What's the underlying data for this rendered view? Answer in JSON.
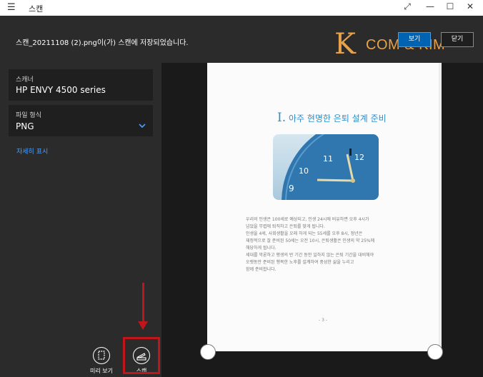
{
  "window": {
    "title": "스캔",
    "menu_glyph": "☰",
    "controls": {
      "restore": "⤢",
      "minimize": "—",
      "maximize": "☐",
      "close": "✕"
    }
  },
  "notification": {
    "message": "스캔_20211108 (2).png이(가) 스캔에 저장되었습니다.",
    "view_label": "보기",
    "close_label": "닫기"
  },
  "watermark": {
    "letter": "K",
    "text": "COM & KIM"
  },
  "settings": {
    "scanner_label": "스캐너",
    "scanner_value": "HP ENVY 4500 series",
    "format_label": "파일 형식",
    "format_value": "PNG",
    "more_link": "자세히 표시"
  },
  "actions": {
    "preview_label": "미리 보기",
    "scan_label": "스캔"
  },
  "document": {
    "heading_number": "I.",
    "heading_text": "아주 현명한 은퇴 설계 준비",
    "clock_numbers": [
      "9",
      "10",
      "11",
      "12"
    ],
    "body_lines": [
      "우리의 인생은 100세로 예상되고, 인생 24시에 비유하면 오후 4시가",
      "넘었을 무렵에 퇴직하고 은퇴를 맞게 됩니다.",
      "인생을 4세, 사회생활을 오래 하게 되는 55세를 오후 8시, 정년은",
      "재정적으로 잘 준비된 50세는 오전 10시, 은퇴생활은 인생의 약 25%에",
      "해당하게 됩니다.",
      "세대를 막론하고 평생의 반 기간 동안 일하지 않는 은퇴 기간을 대비해야",
      "오랫동안 준비된 행복한 노후를 설계하여 풍성한 삶을 누리고",
      "함께 준비합니다."
    ],
    "page_number": "- 3 -"
  },
  "colors": {
    "accent": "#0063b1",
    "link": "#4aa0ff",
    "highlight": "#c0151b",
    "heading": "#2e8ec9",
    "watermark": "#e8a24a"
  }
}
